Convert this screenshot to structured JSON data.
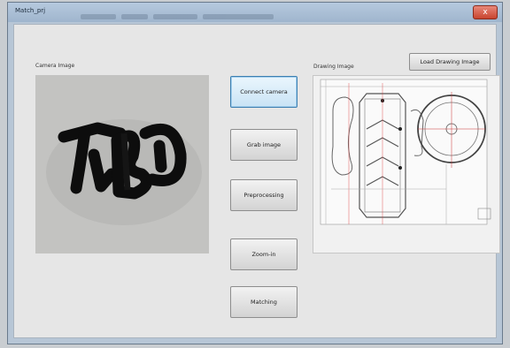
{
  "window": {
    "title": "Match_prj",
    "close_label": "x"
  },
  "camera": {
    "label": "Camera Image"
  },
  "drawing": {
    "label": "Drawing Image"
  },
  "buttons": {
    "load_drawing": "Load Drawing Image",
    "connect_camera": "Connect camera",
    "grab_image": "Grab image",
    "preprocessing": "Preprocessing",
    "zoom_in": "Zoom-in",
    "matching": "Matching"
  }
}
